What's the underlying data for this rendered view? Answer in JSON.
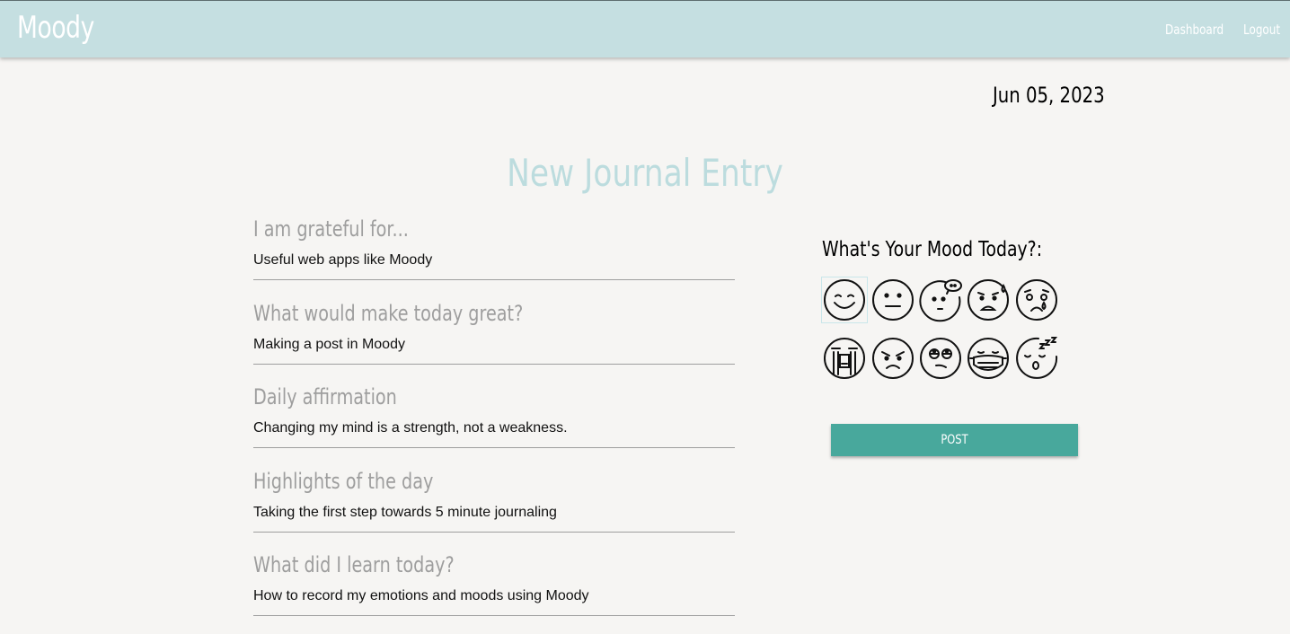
{
  "navbar": {
    "brand": "Moody",
    "links": [
      {
        "label": "Dashboard"
      },
      {
        "label": "Logout"
      }
    ],
    "background": "#c5dfe1"
  },
  "date": "Jun 05, 2023",
  "page_title": "New Journal Entry",
  "entries": [
    {
      "prompt": "I am grateful for...",
      "answer": "Useful web apps like Moody"
    },
    {
      "prompt": "What would make today great?",
      "answer": "Making a post in Moody"
    },
    {
      "prompt": "Daily affirmation",
      "answer": "Changing my mind is a strength, not a weakness."
    },
    {
      "prompt": "Highlights of the day",
      "answer": "Taking the first step towards 5 minute journaling"
    },
    {
      "prompt": "What did I learn today?",
      "answer": "How to record my emotions and moods using Moody"
    }
  ],
  "mood": {
    "title": "What's Your Mood Today?:",
    "selected": "happy",
    "options": [
      {
        "id": "happy",
        "icon": "smiling-face-icon"
      },
      {
        "id": "neutral",
        "icon": "neutral-face-icon"
      },
      {
        "id": "thinking",
        "icon": "thinking-face-icon"
      },
      {
        "id": "anxious",
        "icon": "anxious-sweat-face-icon"
      },
      {
        "id": "sad",
        "icon": "crying-face-icon"
      },
      {
        "id": "sobbing",
        "icon": "sobbing-face-icon"
      },
      {
        "id": "angry",
        "icon": "angry-face-icon"
      },
      {
        "id": "eye-roll",
        "icon": "eye-roll-face-icon"
      },
      {
        "id": "sick",
        "icon": "mask-face-icon"
      },
      {
        "id": "sleepy",
        "icon": "sleeping-face-icon"
      }
    ]
  },
  "post_button": {
    "label": "POST",
    "color": "#48a89c"
  },
  "colors": {
    "accent": "#48a89c",
    "title": "#bcdcde",
    "prompt": "#9e9e9e"
  }
}
